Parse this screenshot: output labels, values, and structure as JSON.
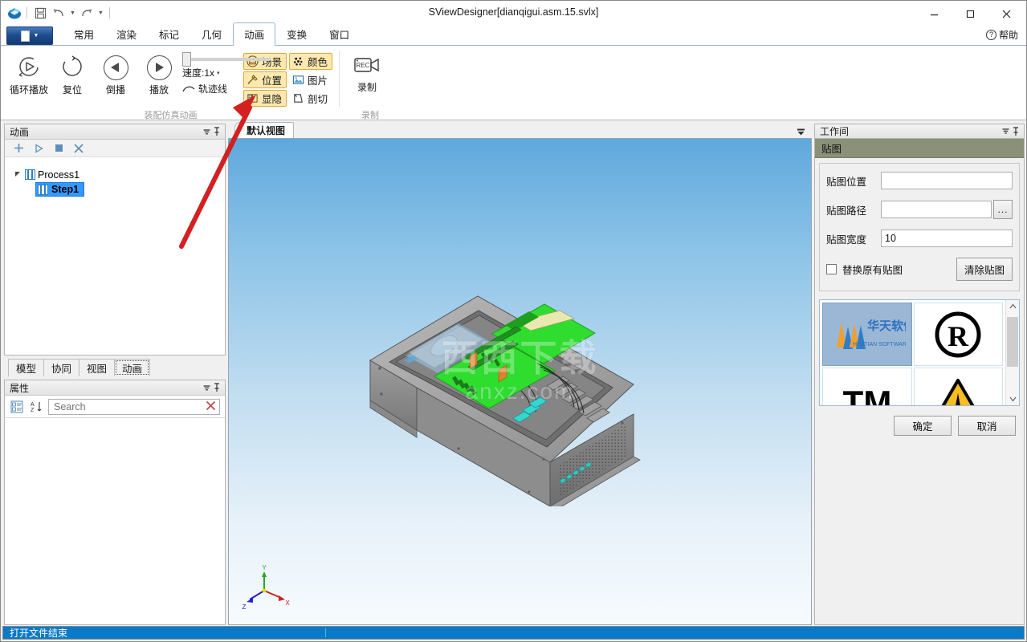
{
  "window": {
    "title": "SViewDesigner[dianqigui.asm.15.svlx]",
    "minimize": "–",
    "maximize": "❐",
    "close": "✕",
    "help_label": "帮助",
    "help_icon": "?"
  },
  "quick_access": {
    "logo": "app-logo",
    "items": [
      {
        "name": "save-icon",
        "glyph": "Ὃe"
      },
      {
        "name": "undo-icon",
        "glyph": "↶"
      },
      {
        "name": "redo-icon",
        "glyph": "↷"
      }
    ]
  },
  "ribbon": {
    "file_button": "file-menu-button",
    "tabs": [
      {
        "label": "常用",
        "active": false
      },
      {
        "label": "渲染",
        "active": false
      },
      {
        "label": "标记",
        "active": false
      },
      {
        "label": "几何",
        "active": false
      },
      {
        "label": "动画",
        "active": true
      },
      {
        "label": "变换",
        "active": false
      },
      {
        "label": "窗口",
        "active": false
      }
    ],
    "groups": [
      {
        "label": "装配仿真动画",
        "big_buttons": [
          {
            "label": "循环播放",
            "icon": "loop-play-icon"
          },
          {
            "label": "复位",
            "icon": "reset-icon"
          },
          {
            "label": "倒播",
            "icon": "reverse-play-icon"
          },
          {
            "label": "播放",
            "icon": "play-icon"
          }
        ],
        "speed": {
          "label": "速度:1x",
          "caret": "▾",
          "slider_value": 0
        },
        "track": {
          "label": "轨迹线",
          "icon": "trajectory-icon"
        },
        "small_buttons": [
          {
            "label": "场景",
            "icon": "scene-icon",
            "highlighted": true
          },
          {
            "label": "颜色",
            "icon": "color-icon",
            "highlighted": true
          },
          {
            "label": "位置",
            "icon": "position-icon",
            "highlighted": true
          },
          {
            "label": "图片",
            "icon": "picture-icon",
            "highlighted": false
          },
          {
            "label": "显隐",
            "icon": "show-hide-icon",
            "highlighted": true
          },
          {
            "label": "剖切",
            "icon": "section-cut-icon",
            "highlighted": false
          }
        ]
      },
      {
        "label": "录制",
        "record_button": {
          "label": "录制",
          "icon": "record-camera-icon"
        }
      }
    ]
  },
  "left_dock": {
    "animation_panel": {
      "title": "动画",
      "collapse_icon": "▾",
      "pin_icon": "pin-icon",
      "toolbar": [
        {
          "name": "add-step-button",
          "glyph": "+"
        },
        {
          "name": "play-button",
          "glyph": "▷"
        },
        {
          "name": "stop-button",
          "glyph": "■"
        },
        {
          "name": "delete-button",
          "glyph": "✕"
        }
      ],
      "tree": {
        "root": {
          "label": "Process1",
          "expanded": true,
          "arrow": "◢"
        },
        "children": [
          {
            "label": "Step1",
            "selected": true
          }
        ]
      }
    },
    "dock_tabs": [
      {
        "label": "模型",
        "active": false
      },
      {
        "label": "协同",
        "active": false
      },
      {
        "label": "视图",
        "active": false
      },
      {
        "label": "动画",
        "active": true
      }
    ],
    "properties_panel": {
      "title": "属性",
      "collapse_icon": "▾",
      "pin_icon": "pin-icon",
      "categorize_icon": "categorize-icon",
      "sort_icon": "sort-az-icon",
      "search_placeholder": "Search",
      "search_value": "",
      "clear_icon": "✕"
    }
  },
  "viewport": {
    "tab_label": "默认视图",
    "dropdown_icon": "▾",
    "watermark_main": "西西下载",
    "watermark_sub": "anxz.com",
    "axis": {
      "x": "X",
      "y": "Y",
      "z": "Z"
    },
    "model_name": "dianqigui-assembly-3d-model"
  },
  "right_dock": {
    "title": "工作间",
    "collapse_icon": "▾",
    "pin_icon": "pin-icon",
    "section_title": "贴图",
    "fields": [
      {
        "label": "贴图位置",
        "value": "",
        "name": "texture-position-field"
      },
      {
        "label": "贴图路径",
        "value": "",
        "name": "texture-path-field",
        "browse": "..."
      },
      {
        "label": "贴图宽度",
        "value": "10",
        "name": "texture-width-field"
      }
    ],
    "checkbox": {
      "label": "替换原有贴图",
      "checked": false
    },
    "clear_button": "清除贴图",
    "gallery": [
      {
        "name": "huatian-software-logo",
        "selected": true,
        "kind": "logo"
      },
      {
        "name": "registered-trademark-symbol",
        "selected": false,
        "kind": "R"
      },
      {
        "name": "trademark-symbol",
        "selected": false,
        "kind": "TM"
      },
      {
        "name": "warning-triangle-symbol",
        "selected": false,
        "kind": "warn"
      }
    ],
    "scrollbar": {
      "up": "∧",
      "down": "∨"
    },
    "ok_button": "确定",
    "cancel_button": "取消"
  },
  "status_bar": {
    "message": "打开文件结束"
  },
  "colors": {
    "accent_blue": "#0a7ac8",
    "ribbon_highlight": "#fde9b0",
    "ribbon_highlight_border": "#e0a93a",
    "selection_blue": "#3399ff",
    "section_header": "#8b9079",
    "annotation_red": "#d32020"
  }
}
